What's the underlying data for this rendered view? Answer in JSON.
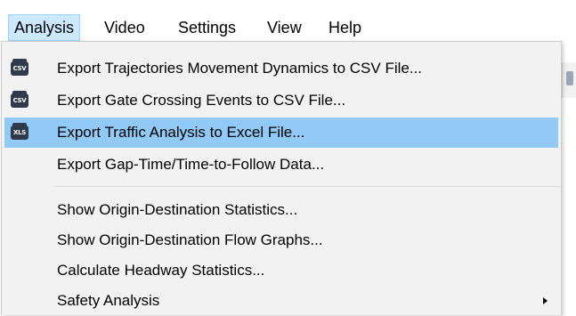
{
  "menubar": {
    "items": [
      {
        "label": "Analysis",
        "active": true
      },
      {
        "label": "Video"
      },
      {
        "label": "Settings"
      },
      {
        "label": "View"
      },
      {
        "label": "Help"
      }
    ]
  },
  "analysis_menu": {
    "highlight_color": "#91c9f7",
    "items": [
      {
        "label": "Export Trajectories Movement Dynamics to CSV File...",
        "icon": "csv-file-icon",
        "icon_text": "CSV"
      },
      {
        "label": "Export Gate Crossing Events to CSV File...",
        "icon": "csv-file-icon",
        "icon_text": "CSV"
      },
      {
        "label": "Export Traffic Analysis to Excel File...",
        "icon": "xls-file-icon",
        "icon_text": "XLS",
        "highlighted": true
      },
      {
        "label": "Export Gap-Time/Time-to-Follow Data..."
      },
      {
        "label": "Show Origin-Destination Statistics..."
      },
      {
        "label": "Show Origin-Destination Flow Graphs..."
      },
      {
        "label": "Calculate Headway Statistics..."
      },
      {
        "label": "Safety Analysis",
        "has_submenu": true
      }
    ]
  }
}
